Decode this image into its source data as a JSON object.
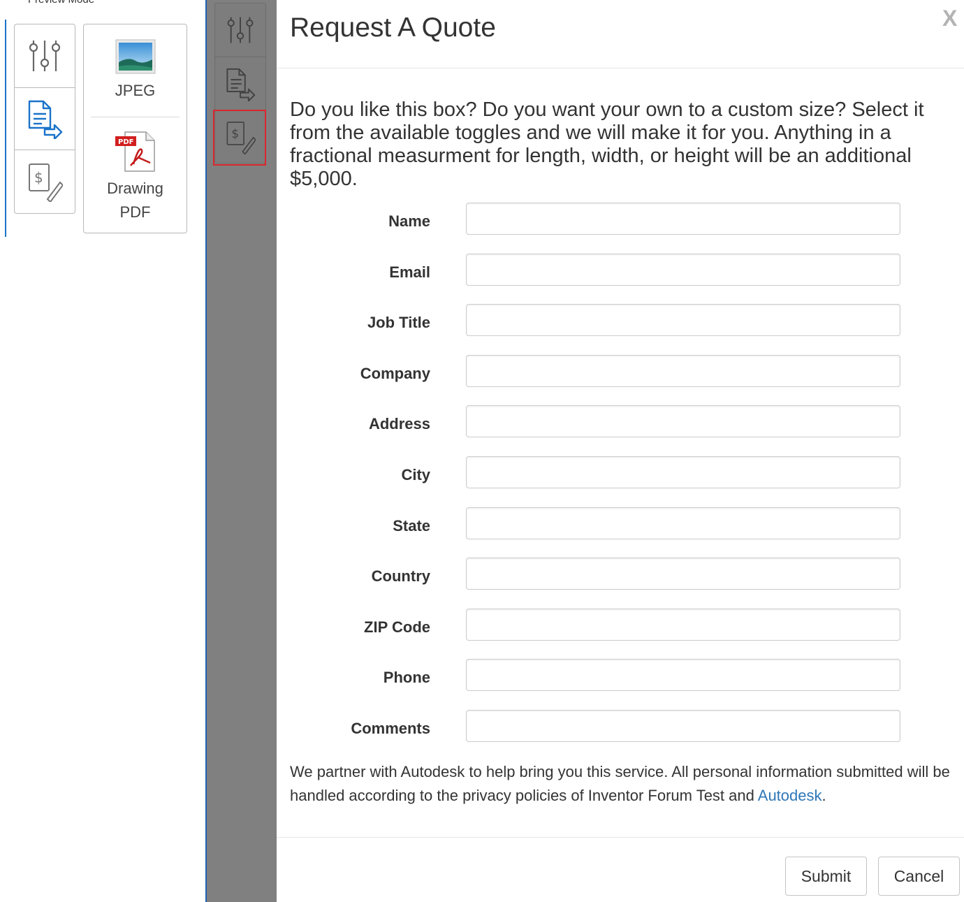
{
  "background": {
    "top_text": "Preview Mode",
    "export_options": [
      {
        "label": "JPEG",
        "icon": "jpeg-image-icon"
      },
      {
        "label": "Drawing PDF",
        "icon": "pdf-icon"
      }
    ],
    "toolbar_icons": [
      "sliders-icon",
      "export-document-icon",
      "quote-dollar-icon"
    ]
  },
  "modal": {
    "title": "Request A Quote",
    "close_label": "X",
    "intro": "Do you like this box? Do you want your own to a custom size? Select it from the available toggles and we will make it for you. Anything in a fractional measurment for length, width, or height will be an additional $5,000.",
    "fields": [
      {
        "label": "Name",
        "value": ""
      },
      {
        "label": "Email",
        "value": ""
      },
      {
        "label": "Job Title",
        "value": ""
      },
      {
        "label": "Company",
        "value": ""
      },
      {
        "label": "Address",
        "value": ""
      },
      {
        "label": "City",
        "value": ""
      },
      {
        "label": "State",
        "value": ""
      },
      {
        "label": "Country",
        "value": ""
      },
      {
        "label": "ZIP Code",
        "value": ""
      },
      {
        "label": "Phone",
        "value": ""
      },
      {
        "label": "Comments",
        "value": ""
      }
    ],
    "privacy_text": "We partner with Autodesk to help bring you this service. All personal information submitted will be handled according to the privacy policies of Inventor Forum Test and ",
    "privacy_link": "Autodesk",
    "privacy_end": ".",
    "submit_label": "Submit",
    "cancel_label": "Cancel"
  },
  "colors": {
    "accent_blue": "#1a73c9",
    "overlay_gray": "#808080",
    "highlight_red": "#d9262e",
    "link_blue": "#2f77b8"
  }
}
